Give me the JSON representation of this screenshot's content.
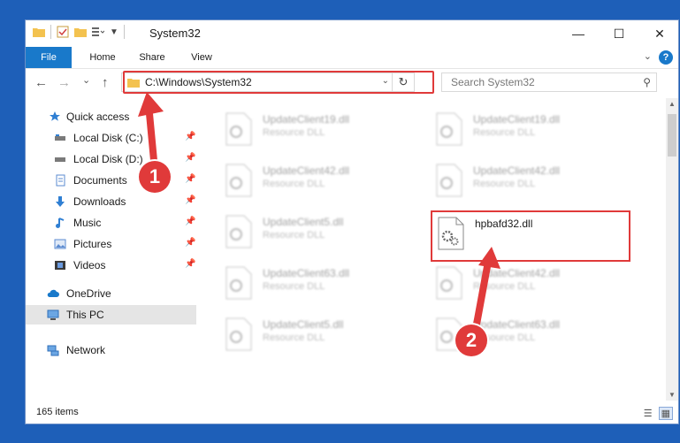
{
  "window": {
    "title": "System32"
  },
  "titlebar": {
    "minimize": "—",
    "maximize": "☐",
    "close": "✕"
  },
  "ribbon": {
    "tabs": [
      "File",
      "Home",
      "Share",
      "View"
    ],
    "help": "?"
  },
  "nav": {
    "back": "←",
    "forward": "→",
    "recent": "⌄",
    "up": "↑"
  },
  "address": {
    "path": "C:\\Windows\\System32"
  },
  "search": {
    "placeholder": "Search System32"
  },
  "sidebar": {
    "items": [
      {
        "label": "Quick access",
        "icon": "star-icon"
      },
      {
        "label": "Local Disk (C:)",
        "icon": "drive-icon"
      },
      {
        "label": "Local Disk (D:)",
        "icon": "drive-icon"
      },
      {
        "label": "Documents",
        "icon": "documents-icon"
      },
      {
        "label": "Downloads",
        "icon": "download-icon"
      },
      {
        "label": "Music",
        "icon": "music-icon"
      },
      {
        "label": "Pictures",
        "icon": "pictures-icon"
      },
      {
        "label": "Videos",
        "icon": "videos-icon"
      },
      {
        "label": "OneDrive",
        "icon": "cloud-icon"
      },
      {
        "label": "This PC",
        "icon": "computer-icon"
      },
      {
        "label": "Network",
        "icon": "network-icon"
      }
    ]
  },
  "files": [
    {
      "name": "UpdateClient19.dll",
      "type": "Resource DLL"
    },
    {
      "name": "UpdateClient19.dll",
      "type": "Resource DLL"
    },
    {
      "name": "UpdateClient42.dll",
      "type": "Resource DLL"
    },
    {
      "name": "UpdateClient42.dll",
      "type": "Resource DLL"
    },
    {
      "name": "UpdateClient5.dll",
      "type": "Resource DLL"
    },
    {
      "name": "hpbafd32.dll",
      "type": ""
    },
    {
      "name": "UpdateClient63.dll",
      "type": "Resource DLL"
    },
    {
      "name": "UpdateClient42.dll",
      "type": "Resource DLL"
    },
    {
      "name": "UpdateClient5.dll",
      "type": "Resource DLL"
    },
    {
      "name": "UpdateClient63.dll",
      "type": "Resource DLL"
    }
  ],
  "status": {
    "items": "165 items"
  },
  "callouts": [
    "1",
    "2"
  ],
  "colors": {
    "accent": "#1979ca",
    "highlight": "#e03a3a",
    "desktop": "#1e5fb8"
  }
}
